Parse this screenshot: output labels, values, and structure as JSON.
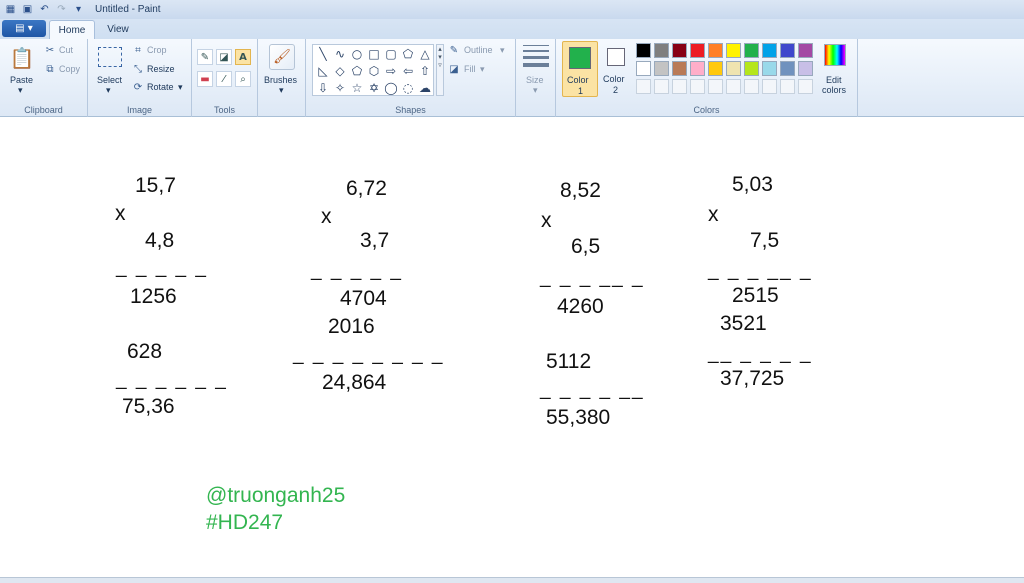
{
  "window": {
    "title": "Untitled - Paint"
  },
  "tabs": [
    {
      "label": "Home"
    },
    {
      "label": "View"
    }
  ],
  "clipboard": {
    "paste": "Paste",
    "cut": "Cut",
    "copy": "Copy",
    "group": "Clipboard"
  },
  "image": {
    "select": "Select",
    "crop": "Crop",
    "resize": "Resize",
    "rotate": "Rotate",
    "group": "Image"
  },
  "tools": {
    "group": "Tools"
  },
  "brushes": {
    "label": "Brushes"
  },
  "shapes": {
    "outline": "Outline",
    "fill": "Fill",
    "group": "Shapes"
  },
  "size": {
    "label": "Size"
  },
  "colors": {
    "color1_line1": "Color",
    "color1_line2": "1",
    "color2_line1": "Color",
    "color2_line2": "2",
    "edit_line1": "Edit",
    "edit_line2": "colors",
    "group": "Colors",
    "color1": "#22b14c",
    "color2": "#ffffff",
    "palette_row1": [
      "#000000",
      "#7f7f7f",
      "#880015",
      "#ed1c24",
      "#ff7f27",
      "#fff200",
      "#22b14c",
      "#00a2e8",
      "#3f48cc",
      "#a349a4"
    ],
    "palette_row2": [
      "#ffffff",
      "#c3c3c3",
      "#b97a57",
      "#ffaec9",
      "#ffc90e",
      "#efe4b0",
      "#b5e61d",
      "#99d9ea",
      "#7092be",
      "#c8bfe7"
    ]
  },
  "canvas": {
    "p1": {
      "a": "15,7",
      "op": "x",
      "b": "4,8",
      "d1": "_ _ _ _  _",
      "r1": "1256",
      "r2": "628",
      "d2": "_ _ _ _  _ _",
      "res": "75,36"
    },
    "p2": {
      "a": "6,72",
      "op": "x",
      "b": "3,7",
      "d1": "_ _ _ _ _",
      "r1": "4704",
      "r2": "2016",
      "d2": "_ _ _ _ _ _ _ _",
      "res": "24,864"
    },
    "p3": {
      "a": "8,52",
      "op": "x",
      "b": "6,5",
      "d1": "_ _ _ __ _",
      "r1": "4260",
      "r2": "5112",
      "d2": "_ _ _ _ __",
      "res": "55,380"
    },
    "p4": {
      "a": "5,03",
      "op": "x",
      "b": "7,5",
      "d1": "_ _  _ __ _",
      "r1": "2515",
      "r2": "3521",
      "d2": "__ _  _ _ _",
      "res": "37,725"
    },
    "sig1": "@truonganh25",
    "sig2": "#HD247"
  }
}
